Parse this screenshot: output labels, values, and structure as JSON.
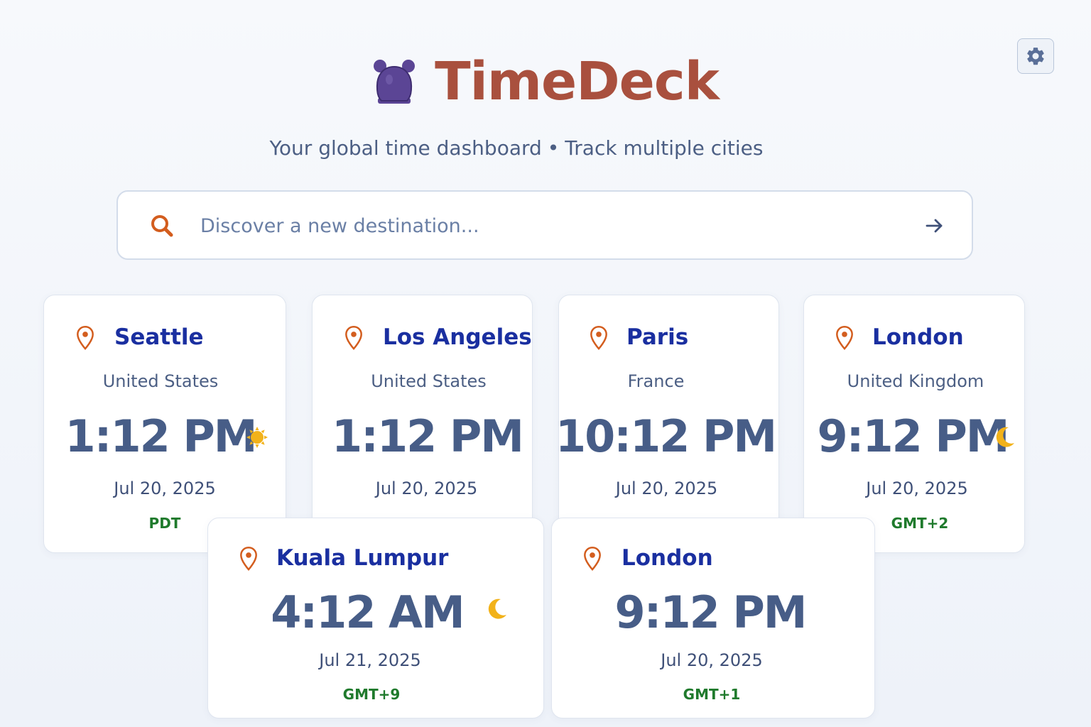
{
  "app": {
    "title": "TimeDeck",
    "subtitle_left": "Your global time dashboard",
    "subtitle_sep": "•",
    "subtitle_right": "Track multiple cities",
    "logo_icon": "alarm-clock-icon",
    "settings_icon": "gear-icon",
    "colors": {
      "brand": "#a9503e",
      "logo": "#5b4595",
      "city": "#1a2fa0",
      "time": "#475d87",
      "timezone": "#1f7a2c",
      "pin": "#d35d1e",
      "sun": "#f2b21a"
    }
  },
  "search": {
    "placeholder": "Discover a new destination...",
    "value": "",
    "icon": "search-icon",
    "submit_icon": "arrow-right-icon"
  },
  "cards": [
    {
      "city": "Seattle",
      "country": "United States",
      "time": "1:12 PM",
      "date": "Jul 20, 2025",
      "tz": "PDT",
      "indicator": "sun-icon"
    },
    {
      "city": "Los Angeles",
      "country": "United States",
      "time": "1:12 PM",
      "date": "Jul 20, 2025",
      "tz": "",
      "indicator": ""
    },
    {
      "city": "Paris",
      "country": "France",
      "time": "10:12 PM",
      "date": "Jul 20, 2025",
      "tz": "",
      "indicator": ""
    },
    {
      "city": "London",
      "country": "United Kingdom",
      "time": "9:12 PM",
      "date": "Jul 20, 2025",
      "tz": "GMT+2",
      "indicator": "moon-icon"
    },
    {
      "city": "Kuala Lumpur",
      "country": "",
      "time": "4:12 AM",
      "date": "Jul 21, 2025",
      "tz": "GMT+9",
      "indicator": "moon-icon"
    },
    {
      "city": "London",
      "country": "",
      "time": "9:12 PM",
      "date": "Jul 20, 2025",
      "tz": "GMT+1",
      "indicator": ""
    }
  ]
}
